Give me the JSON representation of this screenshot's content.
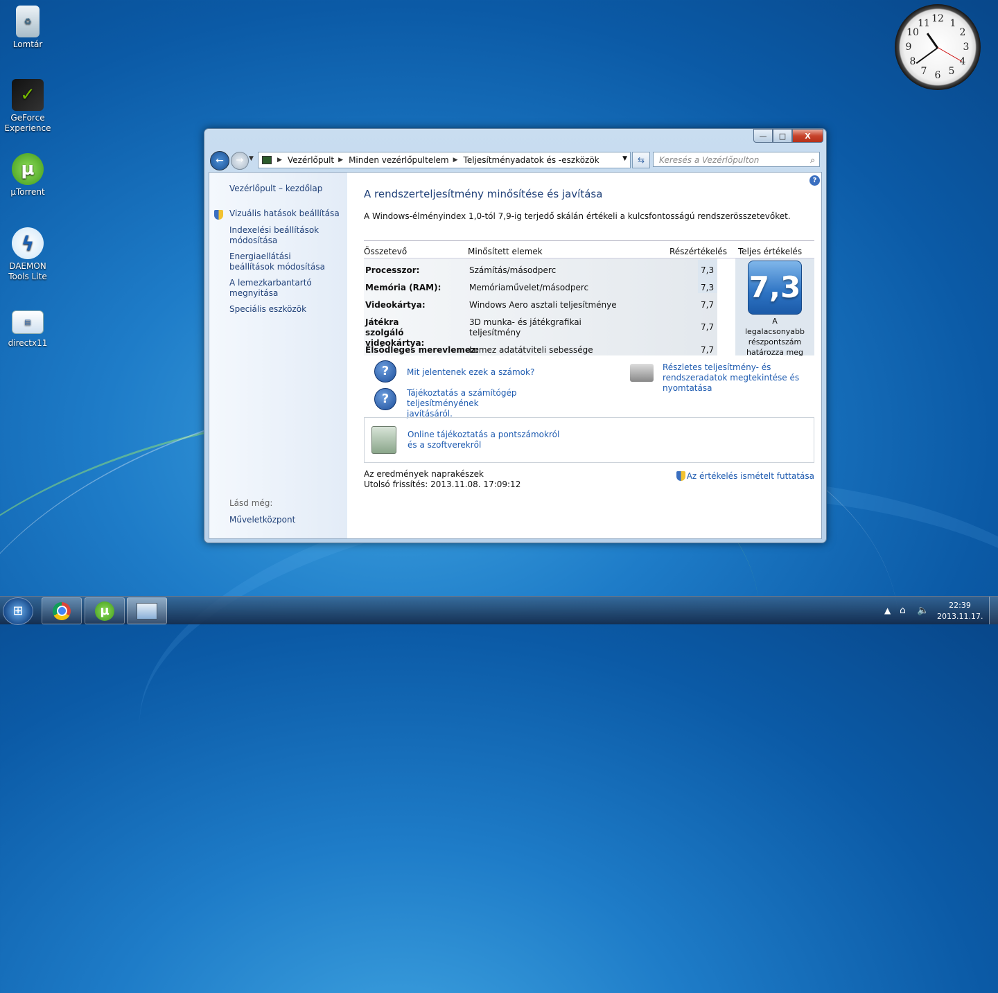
{
  "desktop": {
    "icons": [
      {
        "label": "Lomtár",
        "icon": "recycle-bin-icon"
      },
      {
        "label": "GeForce Experience",
        "icon": "geforce-icon"
      },
      {
        "label": "µTorrent",
        "icon": "utorrent-icon"
      },
      {
        "label": "DAEMON Tools Lite",
        "icon": "daemon-tools-icon"
      },
      {
        "label": "directx11",
        "icon": "directx-icon"
      }
    ],
    "clock_numbers": [
      "12",
      "1",
      "2",
      "3",
      "4",
      "5",
      "6",
      "7",
      "8",
      "9",
      "10",
      "11"
    ]
  },
  "window": {
    "buttons": {
      "minimize": "—",
      "maximize": "□",
      "close": "X"
    },
    "breadcrumb": [
      "Vezérlőpult",
      "Minden vezérlőpultelem",
      "Teljesítményadatok és -eszközök"
    ],
    "search_placeholder": "Keresés a Vezérlőpulton",
    "sidebar": {
      "home": "Vezérlőpult – kezdőlap",
      "items": [
        {
          "label": "Vizuális hatások beállítása",
          "shield": true
        },
        {
          "label": "Indexelési beállítások módosítása",
          "shield": false
        },
        {
          "label": "Energiaellátási beállítások módosítása",
          "shield": false
        },
        {
          "label": "A lemezkarbantartó megnyitása",
          "shield": false
        },
        {
          "label": "Speciális eszközök",
          "shield": false
        }
      ],
      "see_also": "Lásd még:",
      "see_also_link": "Műveletközpont"
    },
    "main": {
      "title": "A rendszerteljesítmény minősítése és javítása",
      "description": "A Windows-élményindex 1,0-tól 7,9-ig terjedő skálán értékeli a kulcsfontosságú rendszerösszetevőket.",
      "table": {
        "headers": [
          "Összetevő",
          "Minősített elemek",
          "Részértékelés",
          "Teljes értékelés"
        ],
        "rows": [
          {
            "component": "Processzor:",
            "rated": "Számítás/másodperc",
            "subscore": "7,3"
          },
          {
            "component": "Memória (RAM):",
            "rated": "Memóriaművelet/másodperc",
            "subscore": "7,3"
          },
          {
            "component": "Videokártya:",
            "rated": "Windows Aero asztali teljesítménye",
            "subscore": "7,7"
          },
          {
            "component": "Játékra szolgáló videokártya:",
            "rated": "3D munka- és játékgrafikai teljesítmény",
            "subscore": "7,7"
          },
          {
            "component": "Elsődleges merevlemez:",
            "rated": "Lemez adatátviteli sebessége",
            "subscore": "7,7"
          }
        ],
        "base_score": "7,3",
        "base_score_note": "A legalacsonyabb részpontszám határozza meg"
      },
      "links": {
        "what_numbers": "Mit jelentenek ezek a számok?",
        "improve": "Tájékoztatás a számítógép teljesítményének javításáról.",
        "detailed": "Részletes teljesítmény- és rendszeradatok megtekintése és nyomtatása",
        "online": "Online tájékoztatás a pontszámokról és a szoftverekről"
      },
      "status_line1": "Az eredmények naprakészek",
      "status_line2": "Utolsó frissítés: 2013.11.08. 17:09:12",
      "rerun": "Az értékelés ismételt futtatása"
    }
  },
  "taskbar": {
    "time": "22:39",
    "date": "2013.11.17.",
    "tray_arrow": "▲"
  }
}
